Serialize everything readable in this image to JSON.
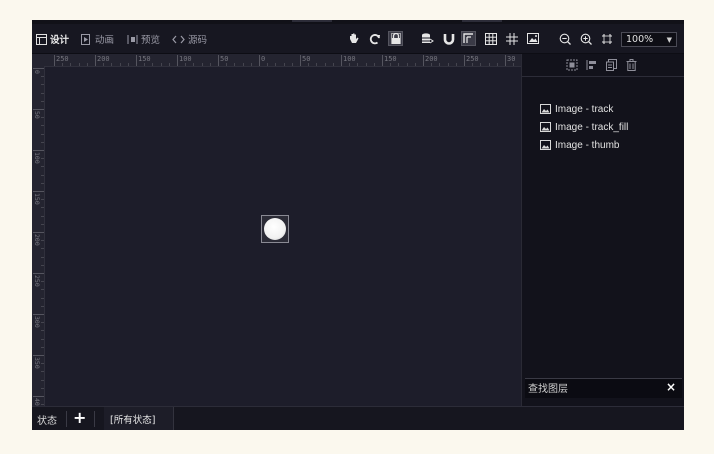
{
  "toolbar": {
    "modes": [
      {
        "label": "设计",
        "icon": "design-icon",
        "active": true
      },
      {
        "label": "动画",
        "icon": "animation-icon",
        "active": false
      },
      {
        "label": "预览",
        "icon": "preview-icon",
        "active": false
      },
      {
        "label": "源码",
        "icon": "source-code-icon",
        "active": false
      }
    ],
    "tools": [
      "hand-icon",
      "refresh-icon",
      "lock-icon",
      "database-icon",
      "magnet-icon",
      "layout-icon",
      "grid-icon",
      "hash-grid-icon",
      "image-icon",
      "zoom-out-icon",
      "zoom-in-icon",
      "fit-screen-icon"
    ],
    "zoom": "100%"
  },
  "ruler": {
    "horizontal": [
      "250",
      "200",
      "150",
      "100",
      "50",
      "0",
      "50",
      "100",
      "150",
      "200",
      "250",
      "30"
    ],
    "vertical": [
      "0",
      "50",
      "100",
      "150",
      "200",
      "250",
      "300",
      "350",
      "400",
      "450"
    ]
  },
  "layers": {
    "tools": [
      "select-layer-icon",
      "align-icon",
      "copy-layer-icon",
      "delete-icon"
    ],
    "items": [
      {
        "label": "Image - track"
      },
      {
        "label": "Image - track_fill"
      },
      {
        "label": "Image - thumb"
      }
    ],
    "search": {
      "placeholder": "查找图层",
      "clear": "×"
    }
  },
  "statusbar": {
    "label": "状态",
    "add": "+",
    "tab": "[所有状态]"
  }
}
